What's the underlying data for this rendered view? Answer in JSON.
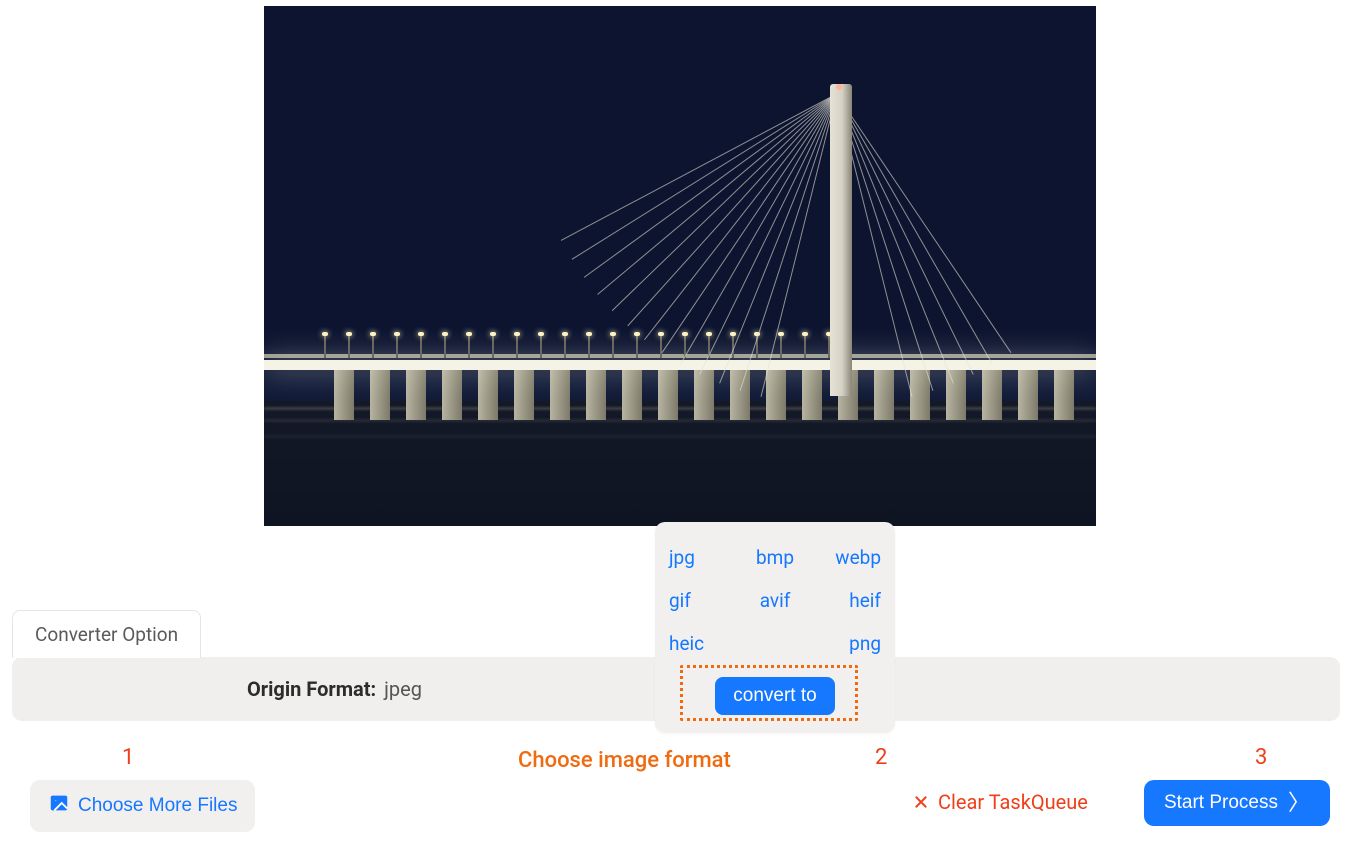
{
  "tab": {
    "label": "Converter Option"
  },
  "panel": {
    "origin_label": "Origin Format:",
    "origin_value": "jpeg"
  },
  "format_popover": {
    "options": [
      "jpg",
      "bmp",
      "webp",
      "gif",
      "avif",
      "heif",
      "heic",
      "",
      "png"
    ],
    "convert_label": "convert to"
  },
  "steps": {
    "n1": "1",
    "n2": "2",
    "n3": "3",
    "hint": "Choose image format"
  },
  "actions": {
    "choose_more": "Choose More Files",
    "clear_queue": "Clear TaskQueue",
    "start": "Start Process"
  },
  "colors": {
    "accent": "#1677ff",
    "warn": "#f03e19",
    "hint": "#f06a10"
  }
}
